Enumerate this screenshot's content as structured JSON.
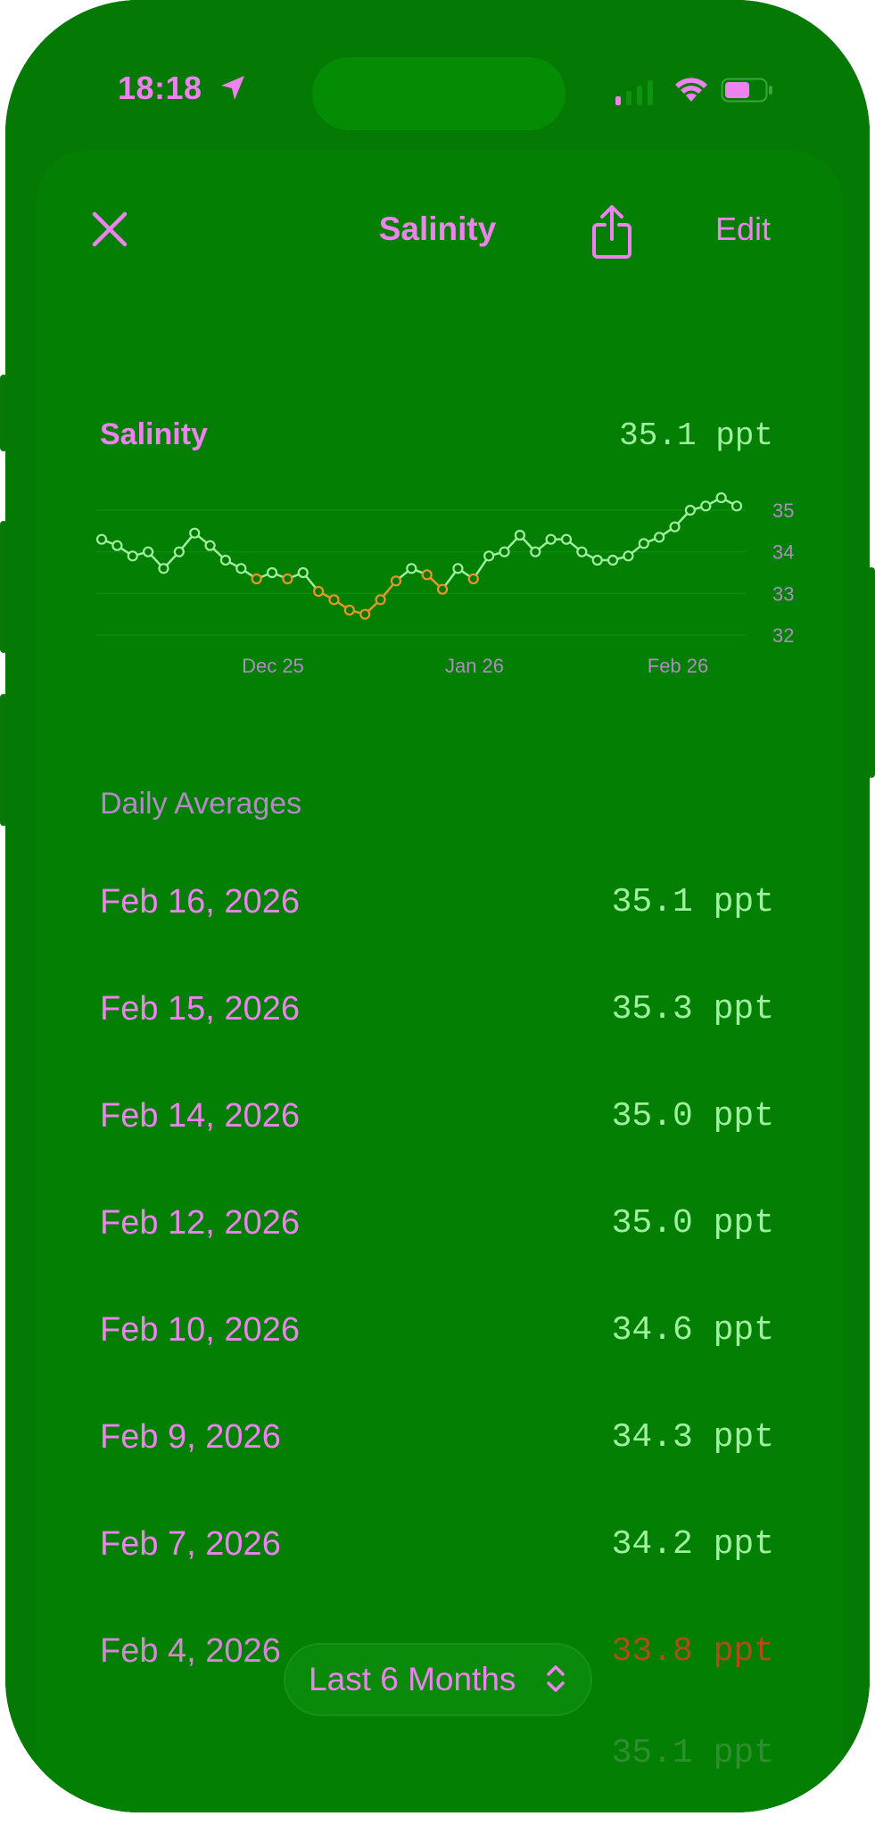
{
  "status_bar": {
    "time": "18:18"
  },
  "header": {
    "title": "Salinity",
    "edit_label": "Edit"
  },
  "summary": {
    "label": "Salinity",
    "value": "35.1 ppt"
  },
  "chart_data": {
    "type": "line",
    "x_tick_labels": [
      "Dec 25",
      "Jan 26",
      "Feb 26"
    ],
    "y_ticks": [
      35,
      34,
      33,
      32
    ],
    "ylim": [
      32,
      35
    ],
    "y_axis_position": "right",
    "values": [
      34.3,
      34.15,
      33.9,
      34.0,
      33.6,
      34.0,
      34.45,
      34.15,
      33.8,
      33.6,
      33.35,
      33.5,
      33.35,
      33.5,
      33.05,
      32.85,
      32.6,
      32.5,
      32.85,
      33.3,
      33.6,
      33.45,
      33.1,
      33.6,
      33.35,
      33.9,
      34.0,
      34.4,
      34.0,
      34.3,
      34.3,
      34.0,
      33.8,
      33.8,
      33.9,
      34.2,
      34.35,
      34.6,
      35.0,
      35.1,
      35.3,
      35.1
    ],
    "colors": {
      "normal": "#9ff09f",
      "low": "#e8952a",
      "dot_fill": "#047a04"
    }
  },
  "list": {
    "header": "Daily Averages",
    "rows": [
      {
        "date": "Feb 16, 2026",
        "value": "35.1 ppt"
      },
      {
        "date": "Feb 15, 2026",
        "value": "35.3 ppt"
      },
      {
        "date": "Feb 14, 2026",
        "value": "35.0 ppt"
      },
      {
        "date": "Feb 12, 2026",
        "value": "35.0 ppt"
      },
      {
        "date": "Feb 10, 2026",
        "value": "34.6 ppt"
      },
      {
        "date": "Feb 9, 2026",
        "value": "34.3 ppt"
      },
      {
        "date": "Feb 7, 2026",
        "value": "34.2 ppt"
      },
      {
        "date": "Feb 4, 2026",
        "value": "33.8 ppt"
      }
    ]
  },
  "range_selector": {
    "label": "Last 6 Months"
  },
  "icons": {
    "close": "close-icon",
    "share": "share-icon",
    "location": "location-arrow-icon",
    "signal": "cellular-signal-icon",
    "wifi": "wifi-icon",
    "battery": "battery-icon",
    "updown": "chevron-up-down-icon"
  },
  "colors": {
    "accent": "#ee82ee",
    "value_text": "#9ff09f",
    "background": "#047a04"
  }
}
